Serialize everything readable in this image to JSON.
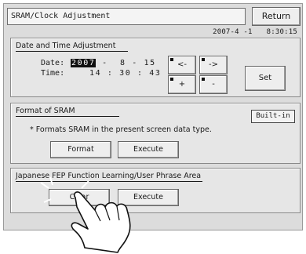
{
  "header": {
    "title": "SRAM/Clock Adjustment",
    "return_label": "Return"
  },
  "status": {
    "date": "2007-4 -1",
    "time": "8:30:15"
  },
  "date_time_panel": {
    "title": "Date and Time Adjustment",
    "date_label": "Date:",
    "date_year": "2007",
    "date_rest": " -  8 - 15",
    "time_label": "Time:",
    "time_value": "14 : 30 : 43",
    "left_label": "<-",
    "right_label": "->",
    "plus_label": "+",
    "minus_label": "-",
    "set_label": "Set"
  },
  "sram_panel": {
    "title": "Format of SRAM",
    "storage_label": "Built-in",
    "note": "* Formats SRAM in the present screen data type.",
    "format_label": "Format",
    "execute_label": "Execute"
  },
  "fep_panel": {
    "title": "Japanese FEP Function Learning/User Phrase Area",
    "clear_label": "Clear",
    "execute_label": "Execute"
  },
  "icons": {
    "pointer": "pointing-hand-icon"
  }
}
